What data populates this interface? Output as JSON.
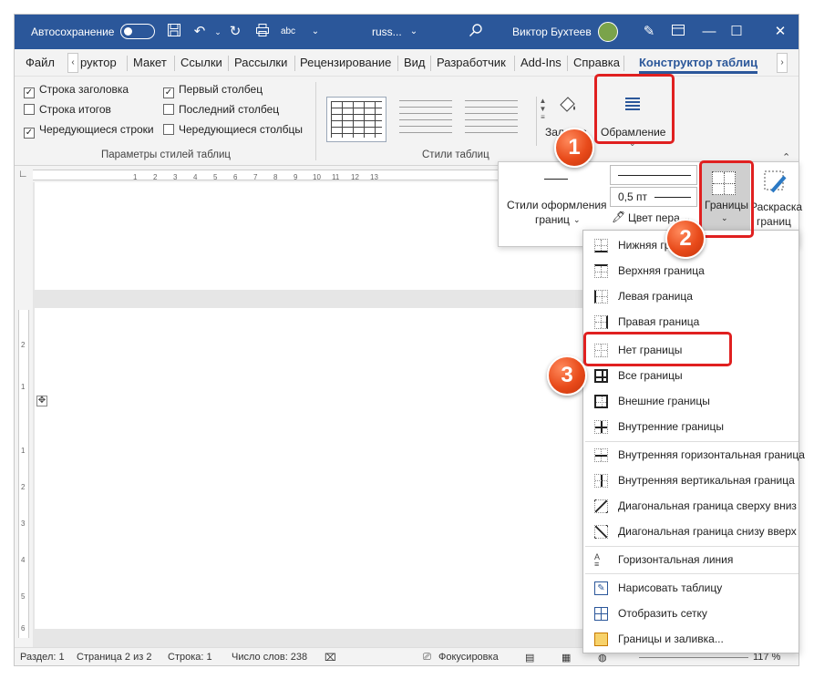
{
  "titlebar": {
    "autosave": "Автосохранение",
    "filename": "russ...",
    "user": "Виктор Бухтеев",
    "ribbon_display_icon": "ribbon-display-icon",
    "minimize": "—",
    "restore": "☐",
    "close": "✕"
  },
  "tabs": [
    "Файл",
    "руктор",
    "Макет",
    "Ссылки",
    "Рассылки",
    "Рецензирование",
    "Вид",
    "Разработчик",
    "Add-Ins",
    "Справка",
    "Конструктор таблиц"
  ],
  "ribbon": {
    "options": {
      "header_row": "Строка заголовка",
      "total_row": "Строка итогов",
      "banded_rows": "Чередующиеся строки",
      "first_column": "Первый столбец",
      "last_column": "Последний столбец",
      "banded_columns": "Чередующиеся столбцы",
      "group_label": "Параметры стилей таблиц"
    },
    "styles_group_label": "Стили таблиц",
    "shading_label": "Заливка",
    "borders_label": "Обрамление"
  },
  "borders_panel": {
    "border_styles": "Стили оформления",
    "border_styles2": "границ",
    "pen_weight": "0,5 пт",
    "pen_color": "Цвет пера",
    "borders_btn": "Границы",
    "painter": "Раскраска",
    "painter2": "границ"
  },
  "menu": [
    "Нижняя граница",
    "Верхняя граница",
    "Левая граница",
    "Правая граница",
    "Нет границы",
    "Все границы",
    "Внешние границы",
    "Внутренние границы",
    "Внутренняя горизонтальная граница",
    "Внутренняя вертикальная граница",
    "Диагональная граница сверху вниз",
    "Диагональная граница снизу вверх",
    "Горизонтальная линия",
    "Нарисовать таблицу",
    "Отобразить сетку",
    "Границы и заливка..."
  ],
  "status": {
    "section": "Раздел: 1",
    "page": "Страница 2 из 2",
    "line": "Строка: 1",
    "words": "Число слов: 238",
    "focus": "Фокусировка",
    "zoom": "117 %"
  },
  "ruler": {
    "h_ticks": [
      "1",
      "2",
      "3",
      "4",
      "5",
      "6",
      "7",
      "8",
      "9",
      "10",
      "11",
      "12",
      "13"
    ],
    "v_ticks": [
      "2",
      "1",
      "1",
      "2",
      "3",
      "4",
      "5",
      "6"
    ]
  },
  "badges": [
    "1",
    "2",
    "3"
  ],
  "colors": {
    "accent": "#2b579a",
    "highlight": "#e02020",
    "badge": "#e84a1a"
  }
}
